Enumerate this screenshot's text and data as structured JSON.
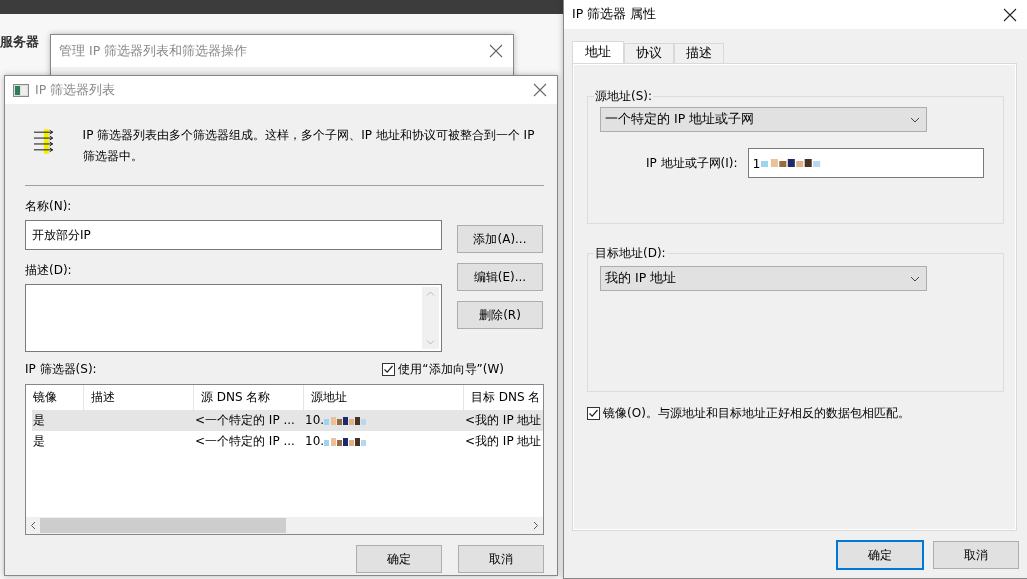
{
  "background": {
    "text": "服务器"
  },
  "back_window": {
    "title": "管理 IP 筛选器列表和筛选器操作"
  },
  "filter_list_window": {
    "title": "IP 筛选器列表",
    "intro": "IP 筛选器列表由多个筛选器组成。这样，多个子网、IP 地址和协议可被整合到一个 IP 筛选器中。",
    "name_label": "名称(N):",
    "name_value": "开放部分IP",
    "description_label": "描述(D):",
    "side_buttons": [
      "添加(A)...",
      "编辑(E)...",
      "删除(R)"
    ],
    "filters_label": "IP 筛选器(S):",
    "wizard": {
      "label": "使用“添加向导”(W)",
      "checked": true
    },
    "table": {
      "columns": [
        "镜像",
        "描述",
        "源 DNS 名称",
        "源地址",
        "目标 DNS 名"
      ],
      "rows": [
        {
          "mirror": "是",
          "source_dns": "<一个特定的 IP ...",
          "source_address": "10.",
          "dest_dns": "<我的 IP 地址",
          "selected": true
        },
        {
          "mirror": "是",
          "source_dns": "<一个特定的 IP ...",
          "source_address": "10.",
          "dest_dns": "<我的 IP 地址",
          "selected": false
        }
      ]
    },
    "footer_buttons": [
      "确定",
      "取消"
    ]
  },
  "properties_window": {
    "title": "IP 筛选器 属性",
    "tabs": [
      {
        "label": "地址",
        "selected": true
      },
      {
        "label": "协议",
        "selected": false
      },
      {
        "label": "描述",
        "selected": false
      }
    ],
    "source": {
      "label": "源地址(S):",
      "value": "一个特定的 IP 地址或子网",
      "ip_label": "IP 地址或子网(I):",
      "ip_value": "1"
    },
    "destination": {
      "label": "目标地址(D):",
      "value": "我的 IP 地址"
    },
    "mirror": {
      "label": "镜像(O)。与源地址和目标地址正好相反的数据包相匹配。",
      "checked": true
    },
    "buttons": [
      {
        "label": "确定",
        "default": true
      },
      {
        "label": "取消",
        "default": false
      }
    ]
  }
}
